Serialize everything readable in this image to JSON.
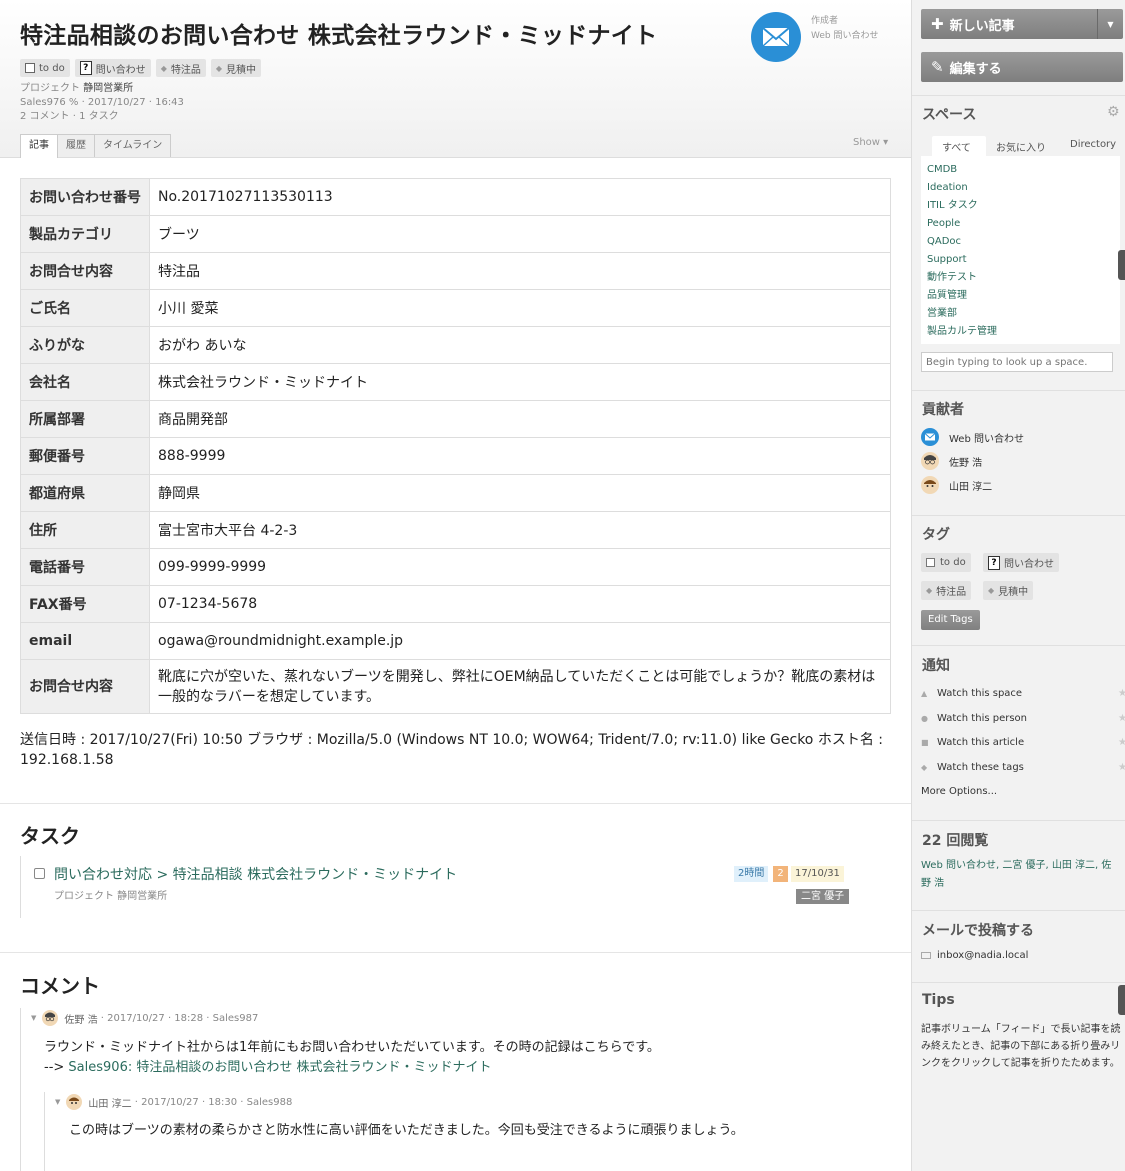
{
  "header": {
    "title": "特注品相談のお問い合わせ 株式会社ラウンド・ミッドナイト",
    "tags": [
      {
        "label": "to do",
        "kind": "checkbox"
      },
      {
        "label": "問い合わせ",
        "kind": "question"
      },
      {
        "label": "特注品",
        "kind": "tag"
      },
      {
        "label": "見積中",
        "kind": "tag"
      }
    ],
    "project_label": "プロジェクト",
    "project_name": "静岡営業所",
    "meta_line": "Sales976 % · 2017/10/27 · 16:43",
    "counts": "2 コメント · 1 タスク",
    "tabs": [
      "記事",
      "履歴",
      "タイムライン"
    ],
    "show_label": "Show ▾",
    "author_caption": "作成者",
    "author_name": "Web 問い合わせ"
  },
  "form_table": [
    {
      "key": "お問い合わせ番号",
      "value": "No.20171027113530113"
    },
    {
      "key": "製品カテゴリ",
      "value": "ブーツ"
    },
    {
      "key": "お問合せ内容",
      "value": "特注品"
    },
    {
      "key": "ご氏名",
      "value": "小川 愛菜"
    },
    {
      "key": "ふりがな",
      "value": "おがわ あいな"
    },
    {
      "key": "会社名",
      "value": "株式会社ラウンド・ミッドナイト"
    },
    {
      "key": "所属部署",
      "value": "商品開発部"
    },
    {
      "key": "郵便番号",
      "value": "888-9999"
    },
    {
      "key": "都道府県",
      "value": "静岡県"
    },
    {
      "key": "住所",
      "value": "富士宮市大平台 4-2-3"
    },
    {
      "key": "電話番号",
      "value": "099-9999-9999"
    },
    {
      "key": "FAX番号",
      "value": "07-1234-5678"
    },
    {
      "key": "email",
      "value": "ogawa@roundmidnight.example.jp"
    },
    {
      "key": "お問合せ内容",
      "value": "靴底に穴が空いた、蒸れないブーツを開発し、弊社にOEM納品していただくことは可能でしょうか？靴底の素材は一般的なラバーを想定しています。"
    }
  ],
  "submit_info": "送信日時 : 2017/10/27(Fri) 10:50 ブラウザ : Mozilla/5.0 (Windows NT 10.0; WOW64; Trident/7.0; rv:11.0) like Gecko ホスト名 : 192.168.1.58",
  "tasks": {
    "heading": "タスク",
    "item": {
      "title": "問い合わせ対応 > 特注品相談 株式会社ラウンド・ミッドナイト",
      "project": "プロジェクト 静岡営業所",
      "estimate": "2時間",
      "count": "2",
      "due": "17/10/31",
      "assignee": "二宮 優子"
    }
  },
  "comments": {
    "heading": "コメント",
    "items": [
      {
        "author": "佐野 浩",
        "meta": "· 2017/10/27 · 18:28 · Sales987",
        "line1": "ラウンド・ミッドナイト社からは1年前にもお問い合わせいただいています。その時の記録はこちらです。",
        "arrow": "-->",
        "link": "Sales906: 特注品相談のお問い合わせ 株式会社ラウンド・ミッドナイト"
      },
      {
        "author": "山田 淳二",
        "meta": "· 2017/10/27 · 18:30 · Sales988",
        "line1": "この時はブーツの素材の柔らかさと防水性に高い評価をいただきました。今回も受注できるように頑張りましょう。"
      }
    ]
  },
  "sidebar": {
    "new_article": "新しい記事",
    "edit": "編集する",
    "spaces_heading": "スペース",
    "space_tabs": [
      "すべて",
      "お気に入り",
      "Directory"
    ],
    "spaces": [
      "CMDB",
      "Ideation",
      "ITIL タスク",
      "People",
      "QADoc",
      "Support",
      "動作テスト",
      "品質管理",
      "営業部",
      "製品カルテ管理"
    ],
    "space_lookup_placeholder": "Begin typing to look up a space.",
    "contributors_heading": "貢献者",
    "contributors": [
      "Web 問い合わせ",
      "佐野 浩",
      "山田 淳二"
    ],
    "tags_heading": "タグ",
    "tags": [
      "to do",
      "問い合わせ",
      "特注品",
      "見積中"
    ],
    "edit_tags": "Edit Tags",
    "notify_heading": "通知",
    "watch": [
      "Watch this space",
      "Watch this person",
      "Watch this article",
      "Watch these tags"
    ],
    "more_options": "More Options...",
    "views_heading": "22 回閲覧",
    "viewers": "Web 問い合わせ, 二宮 優子, 山田 淳二, 佐野 浩",
    "mail_heading": "メールで投稿する",
    "mail_address": "inbox@nadia.local",
    "tips_heading": "Tips",
    "tips_text": "記事ボリューム「フィード」で長い記事を読み終えたとき、記事の下部にある折り畳みリンクをクリックして記事を折りたためます。"
  },
  "colors": {
    "link": "#2b6b5d",
    "author_icon": "#2a8fd6",
    "sidebar_bg": "#f2f2f2",
    "button": "#8a8a8a"
  }
}
